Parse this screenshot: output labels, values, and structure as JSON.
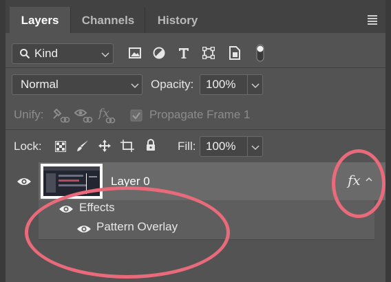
{
  "tabs": [
    {
      "label": "Layers"
    },
    {
      "label": "Channels"
    },
    {
      "label": "History"
    }
  ],
  "filter": {
    "kind_label": "Kind",
    "icons": [
      "image-filter-icon",
      "adjustment-filter-icon",
      "type-filter-icon",
      "shape-filter-icon",
      "smart-object-filter-icon",
      "filter-toggle-icon"
    ]
  },
  "blend": {
    "mode": "Normal",
    "opacity_label": "Opacity:",
    "opacity_value": "100%"
  },
  "unify": {
    "label": "Unify:",
    "propagate_label": "Propagate Frame 1"
  },
  "lock": {
    "label": "Lock:",
    "fill_label": "Fill:",
    "fill_value": "100%"
  },
  "layer": {
    "name": "Layer 0",
    "fx": "fx",
    "effects_label": "Effects",
    "effect_item": "Pattern Overlay"
  },
  "colors": {
    "panel_bg": "#535353",
    "tab_bar_bg": "#424242",
    "selected_layer_bg": "#6a6a6a",
    "annotation": "#e96a7a"
  }
}
